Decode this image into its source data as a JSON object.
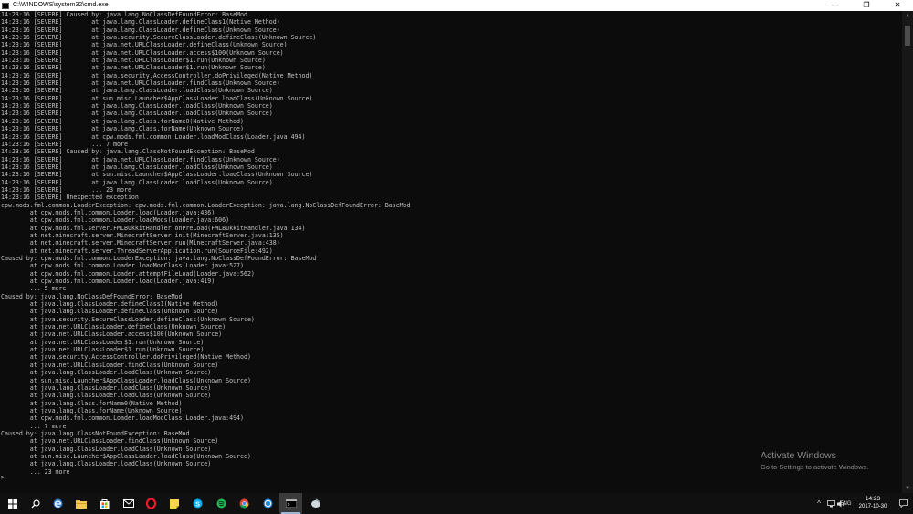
{
  "window": {
    "title": "C:\\WINDOWS\\system32\\cmd.exe",
    "controls": {
      "minimize": "—",
      "maximize": "❐",
      "close": "✕"
    }
  },
  "console": {
    "text": "14:23:16 [SEVERE] Caused by: java.lang.NoClassDefFoundError: BaseMod\n14:23:16 [SEVERE]        at java.lang.ClassLoader.defineClass1(Native Method)\n14:23:16 [SEVERE]        at java.lang.ClassLoader.defineClass(Unknown Source)\n14:23:16 [SEVERE]        at java.security.SecureClassLoader.defineClass(Unknown Source)\n14:23:16 [SEVERE]        at java.net.URLClassLoader.defineClass(Unknown Source)\n14:23:16 [SEVERE]        at java.net.URLClassLoader.access$100(Unknown Source)\n14:23:16 [SEVERE]        at java.net.URLClassLoader$1.run(Unknown Source)\n14:23:16 [SEVERE]        at java.net.URLClassLoader$1.run(Unknown Source)\n14:23:16 [SEVERE]        at java.security.AccessController.doPrivileged(Native Method)\n14:23:16 [SEVERE]        at java.net.URLClassLoader.findClass(Unknown Source)\n14:23:16 [SEVERE]        at java.lang.ClassLoader.loadClass(Unknown Source)\n14:23:16 [SEVERE]        at sun.misc.Launcher$AppClassLoader.loadClass(Unknown Source)\n14:23:16 [SEVERE]        at java.lang.ClassLoader.loadClass(Unknown Source)\n14:23:16 [SEVERE]        at java.lang.ClassLoader.loadClass(Unknown Source)\n14:23:16 [SEVERE]        at java.lang.Class.forName0(Native Method)\n14:23:16 [SEVERE]        at java.lang.Class.forName(Unknown Source)\n14:23:16 [SEVERE]        at cpw.mods.fml.common.Loader.loadModClass(Loader.java:494)\n14:23:16 [SEVERE]        ... 7 more\n14:23:16 [SEVERE] Caused by: java.lang.ClassNotFoundException: BaseMod\n14:23:16 [SEVERE]        at java.net.URLClassLoader.findClass(Unknown Source)\n14:23:16 [SEVERE]        at java.lang.ClassLoader.loadClass(Unknown Source)\n14:23:16 [SEVERE]        at sun.misc.Launcher$AppClassLoader.loadClass(Unknown Source)\n14:23:16 [SEVERE]        at java.lang.ClassLoader.loadClass(Unknown Source)\n14:23:16 [SEVERE]        ... 23 more\n14:23:16 [SEVERE] Unexpected exception\ncpw.mods.fml.common.LoaderException: cpw.mods.fml.common.LoaderException: java.lang.NoClassDefFoundError: BaseMod\n        at cpw.mods.fml.common.Loader.load(Loader.java:436)\n        at cpw.mods.fml.common.Loader.loadMods(Loader.java:606)\n        at cpw.mods.fml.server.FMLBukkitHandler.onPreLoad(FMLBukkitHandler.java:134)\n        at net.minecraft.server.MinecraftServer.init(MinecraftServer.java:135)\n        at net.minecraft.server.MinecraftServer.run(MinecraftServer.java:438)\n        at net.minecraft.server.ThreadServerApplication.run(SourceFile:492)\nCaused by: cpw.mods.fml.common.LoaderException: java.lang.NoClassDefFoundError: BaseMod\n        at cpw.mods.fml.common.Loader.loadModClass(Loader.java:527)\n        at cpw.mods.fml.common.Loader.attemptFileLoad(Loader.java:562)\n        at cpw.mods.fml.common.Loader.load(Loader.java:419)\n        ... 5 more\nCaused by: java.lang.NoClassDefFoundError: BaseMod\n        at java.lang.ClassLoader.defineClass1(Native Method)\n        at java.lang.ClassLoader.defineClass(Unknown Source)\n        at java.security.SecureClassLoader.defineClass(Unknown Source)\n        at java.net.URLClassLoader.defineClass(Unknown Source)\n        at java.net.URLClassLoader.access$100(Unknown Source)\n        at java.net.URLClassLoader$1.run(Unknown Source)\n        at java.net.URLClassLoader$1.run(Unknown Source)\n        at java.security.AccessController.doPrivileged(Native Method)\n        at java.net.URLClassLoader.findClass(Unknown Source)\n        at java.lang.ClassLoader.loadClass(Unknown Source)\n        at sun.misc.Launcher$AppClassLoader.loadClass(Unknown Source)\n        at java.lang.ClassLoader.loadClass(Unknown Source)\n        at java.lang.ClassLoader.loadClass(Unknown Source)\n        at java.lang.Class.forName0(Native Method)\n        at java.lang.Class.forName(Unknown Source)\n        at cpw.mods.fml.common.Loader.loadModClass(Loader.java:494)\n        ... 7 more\nCaused by: java.lang.ClassNotFoundException: BaseMod\n        at java.net.URLClassLoader.findClass(Unknown Source)\n        at java.lang.ClassLoader.loadClass(Unknown Source)\n        at sun.misc.Launcher$AppClassLoader.loadClass(Unknown Source)\n        at java.lang.ClassLoader.loadClass(Unknown Source)\n        ... 23 more",
    "prompt": ">"
  },
  "watermark": {
    "title": "Activate Windows",
    "subtitle": "Go to Settings to activate Windows."
  },
  "taskbar": {
    "icons": [
      "windows-start-icon",
      "search-icon",
      "edge-icon",
      "file-explorer-icon",
      "store-icon",
      "mail-icon",
      "opera-icon",
      "sticky-notes-icon",
      "skype-icon",
      "spotify-icon",
      "chrome-icon",
      "app-icon",
      "cmd-icon",
      "tool-icon"
    ],
    "tray": {
      "chevron": "^",
      "language": "ENG"
    },
    "clock": {
      "time": "14:23",
      "date": "2017-10-30"
    }
  },
  "colors": {
    "console_bg": "#0c0c0c",
    "console_text": "#c0c0c0",
    "taskbar_bg": "#101010",
    "titlebar_bg": "#ffffff"
  }
}
